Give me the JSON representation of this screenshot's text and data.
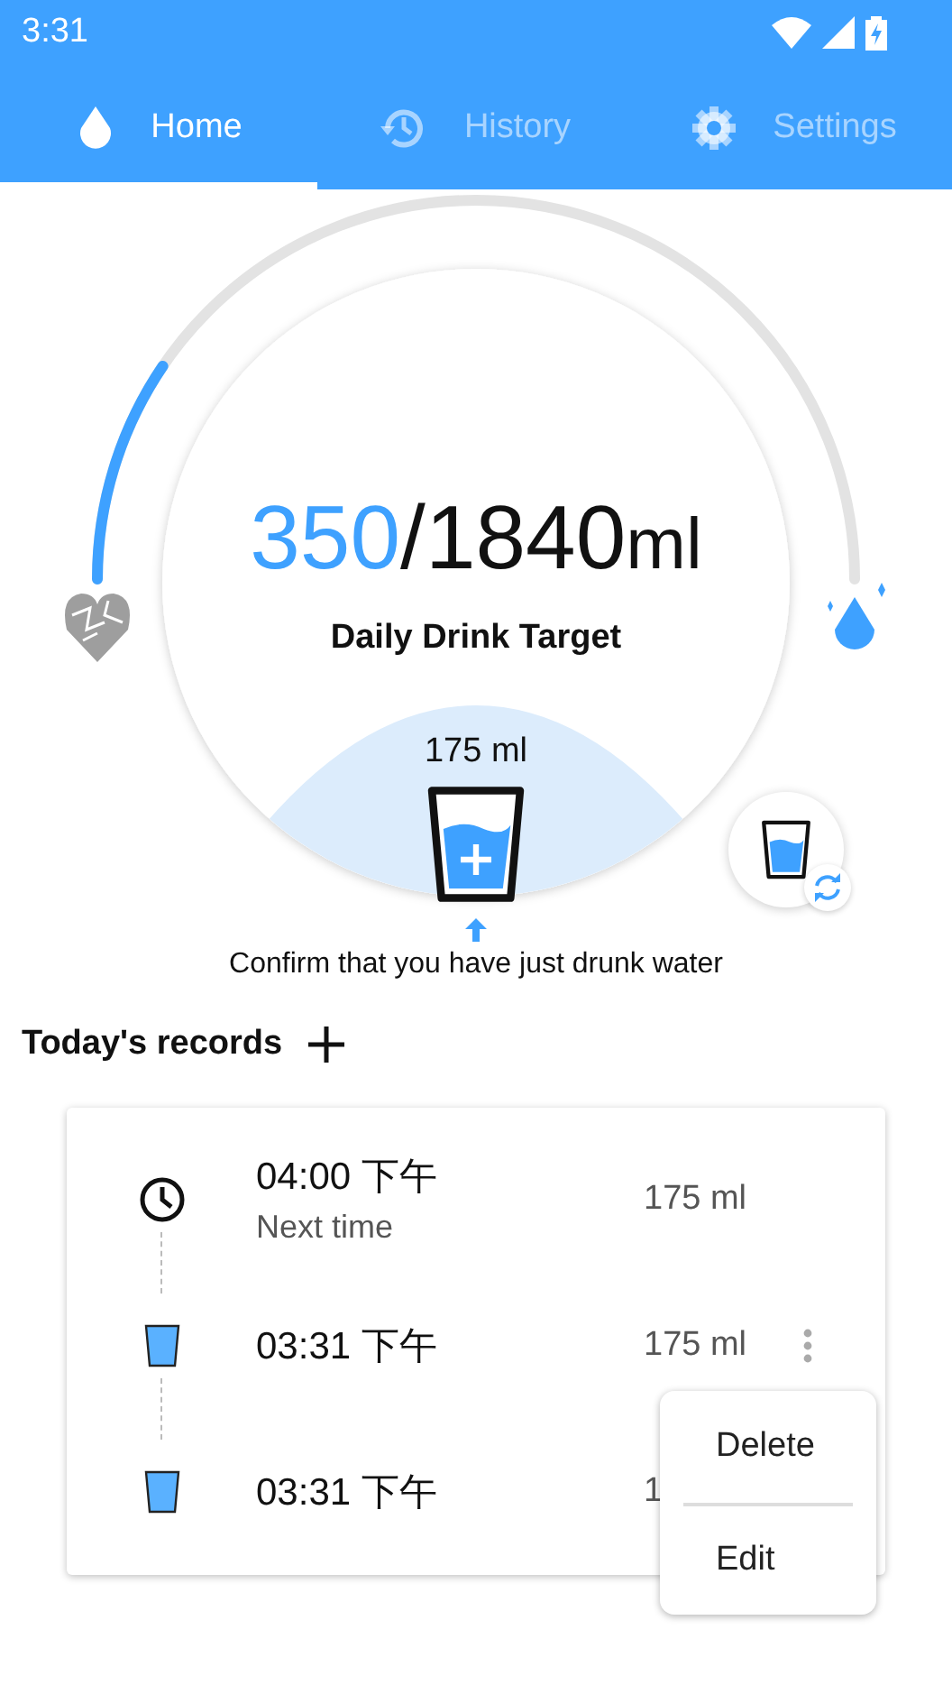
{
  "status_bar": {
    "time": "3:31"
  },
  "tabs": [
    {
      "label": "Home",
      "selected": true
    },
    {
      "label": "History",
      "selected": false
    },
    {
      "label": "Settings",
      "selected": false
    }
  ],
  "gauge": {
    "level": 0.19,
    "current": "350",
    "target": "/1840",
    "unit": "ml",
    "caption": "Daily Drink Target",
    "cup_amount": "175 ml"
  },
  "confirm_text": "Confirm that you have just drunk water",
  "records_title": "Today's records",
  "records": [
    {
      "kind": "reminder",
      "time": "04:00 下午",
      "subtitle": "Next time",
      "amount": "175 ml",
      "more_button": false
    },
    {
      "kind": "drink",
      "time": "03:31 下午",
      "amount": "175 ml",
      "more_button": true
    },
    {
      "kind": "drink",
      "time": "03:31 下午",
      "amount": "1",
      "more_button": false
    }
  ],
  "menu": [
    "Delete",
    "Edit"
  ]
}
